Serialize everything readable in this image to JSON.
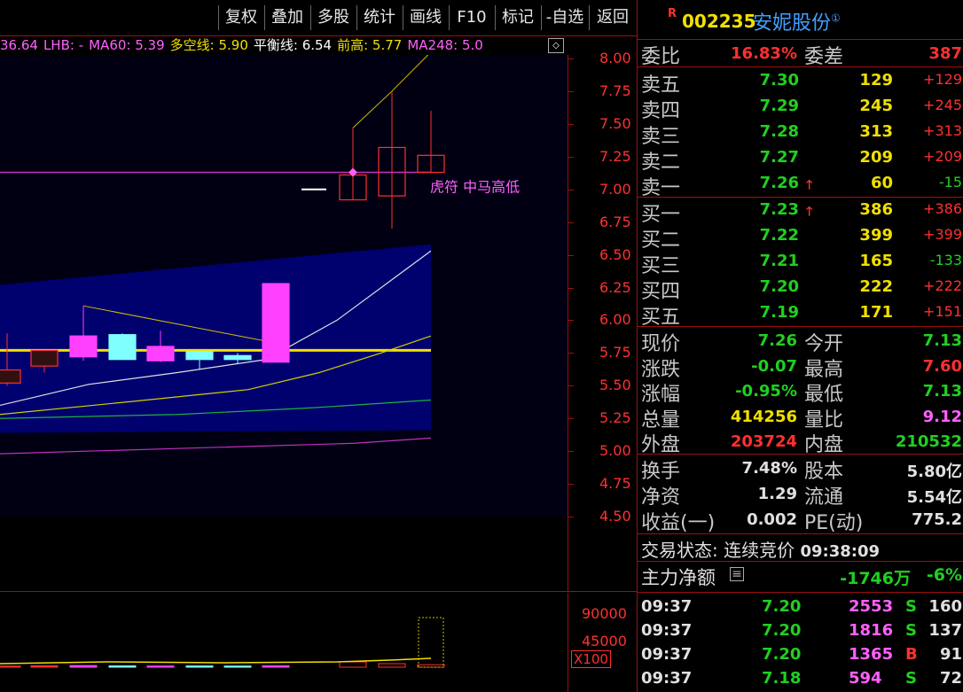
{
  "toolbar": {
    "buttons": [
      "复权",
      "叠加",
      "多股",
      "统计",
      "画线",
      "F10",
      "标记",
      "-自选",
      "返回"
    ]
  },
  "indicator": {
    "items": [
      {
        "text": "36.64",
        "color": "#ff60ff"
      },
      {
        "text": "LHB: -",
        "color": "#ff60ff"
      },
      {
        "text": "MA60: 5.39",
        "color": "#ff60ff"
      },
      {
        "text": "多空线: 5.90",
        "color": "#f0e000"
      },
      {
        "text": "平衡线: 6.54",
        "color": "#ffffff"
      },
      {
        "text": "前高: 5.77",
        "color": "#f0e000"
      },
      {
        "text": "MA248: 5.0",
        "color": "#ff60ff"
      }
    ],
    "icon": "diamond-icon"
  },
  "price_axis": [
    "8.00",
    "7.75",
    "7.50",
    "7.25",
    "7.00",
    "6.75",
    "6.50",
    "6.25",
    "6.00",
    "5.75",
    "5.50",
    "5.25",
    "5.00",
    "4.75",
    "4.50"
  ],
  "annotation": "虎符 中马高低",
  "volume_axis": [
    "90000",
    "45000"
  ],
  "volume_unit": "X100",
  "chart_data": {
    "type": "candlestick",
    "candles": [
      {
        "open": 5.52,
        "close": 5.62,
        "high": 5.9,
        "low": 5.5
      },
      {
        "open": 5.65,
        "close": 5.77,
        "high": 5.77,
        "low": 5.6
      },
      {
        "open": 5.72,
        "close": 5.88,
        "high": 6.11,
        "low": 5.69
      },
      {
        "open": 5.7,
        "close": 5.89,
        "high": 5.9,
        "low": 5.7
      },
      {
        "open": 5.8,
        "close": 5.69,
        "high": 5.92,
        "low": 5.68
      },
      {
        "open": 5.76,
        "close": 5.7,
        "high": 5.76,
        "low": 5.62
      },
      {
        "open": 5.73,
        "close": 5.7,
        "high": 5.75,
        "low": 5.67
      },
      {
        "open": 5.68,
        "close": 6.28,
        "high": 6.28,
        "low": 5.68
      },
      {
        "open": 7.0,
        "close": 7.0,
        "high": 7.0,
        "low": 7.0
      },
      {
        "open": 6.92,
        "close": 7.11,
        "high": 7.47,
        "low": 6.92
      },
      {
        "open": 6.95,
        "close": 7.32,
        "high": 7.75,
        "low": 6.7
      },
      {
        "open": 7.13,
        "close": 7.26,
        "high": 7.6,
        "low": 7.13
      }
    ],
    "volumes": [
      1800,
      2500,
      2800,
      2200,
      2000,
      2100,
      1900,
      2400,
      0,
      9000,
      6000,
      4142
    ],
    "ylim": [
      4.5,
      8.0
    ]
  },
  "panel": {
    "code": "002235",
    "name": "安妮股份",
    "badge": "R",
    "weibi_label": "委比",
    "weibi_value": "16.83%",
    "weicha_label": "委差",
    "weicha_value": "387",
    "asks": [
      {
        "label": "卖五",
        "price": "7.30",
        "vol": "129",
        "chg": "+129"
      },
      {
        "label": "卖四",
        "price": "7.29",
        "vol": "245",
        "chg": "+245"
      },
      {
        "label": "卖三",
        "price": "7.28",
        "vol": "313",
        "chg": "+313"
      },
      {
        "label": "卖二",
        "price": "7.27",
        "vol": "209",
        "chg": "+209"
      },
      {
        "label": "卖一",
        "price": "7.26",
        "vol": "60",
        "chg": "-15"
      }
    ],
    "bids": [
      {
        "label": "买一",
        "price": "7.23",
        "vol": "386",
        "chg": "+386"
      },
      {
        "label": "买二",
        "price": "7.22",
        "vol": "399",
        "chg": "+399"
      },
      {
        "label": "买三",
        "price": "7.21",
        "vol": "165",
        "chg": "-133"
      },
      {
        "label": "买四",
        "price": "7.20",
        "vol": "222",
        "chg": "+222"
      },
      {
        "label": "买五",
        "price": "7.19",
        "vol": "171",
        "chg": "+151"
      }
    ],
    "quote": [
      {
        "l1": "现价",
        "v1": "7.26",
        "c1": "#20d020",
        "l2": "今开",
        "v2": "7.13",
        "c2": "#20d020"
      },
      {
        "l1": "涨跌",
        "v1": "-0.07",
        "c1": "#20d020",
        "l2": "最高",
        "v2": "7.60",
        "c2": "#ff3030"
      },
      {
        "l1": "涨幅",
        "v1": "-0.95%",
        "c1": "#20d020",
        "l2": "最低",
        "v2": "7.13",
        "c2": "#20d020"
      },
      {
        "l1": "总量",
        "v1": "414256",
        "c1": "#f0e000",
        "l2": "量比",
        "v2": "9.12",
        "c2": "#ff60ff"
      },
      {
        "l1": "外盘",
        "v1": "203724",
        "c1": "#ff3030",
        "l2": "内盘",
        "v2": "210532",
        "c2": "#20d020"
      }
    ],
    "info": [
      {
        "l1": "换手",
        "v1": "7.48%",
        "l2": "股本",
        "v2": "5.80亿"
      },
      {
        "l1": "净资",
        "v1": "1.29",
        "l2": "流通",
        "v2": "5.54亿"
      },
      {
        "l1": "收益(一)",
        "v1": "0.002",
        "l2": "PE(动)",
        "v2": "775.2"
      }
    ],
    "status_label": "交易状态:",
    "status_value": "连续竞价",
    "status_time": "09:38:09",
    "netflow_label": "主力净额",
    "netflow_value": "-1746万",
    "netflow_pct": "-6%",
    "ticks": [
      {
        "time": "09:37",
        "price": "7.20",
        "vol": "2553",
        "side": "S",
        "num": "160"
      },
      {
        "time": "09:37",
        "price": "7.20",
        "vol": "1816",
        "side": "S",
        "num": "137"
      },
      {
        "time": "09:37",
        "price": "7.20",
        "vol": "1365",
        "side": "B",
        "num": "91"
      },
      {
        "time": "09:37",
        "price": "7.18",
        "vol": "594",
        "side": "S",
        "num": "72"
      }
    ]
  }
}
